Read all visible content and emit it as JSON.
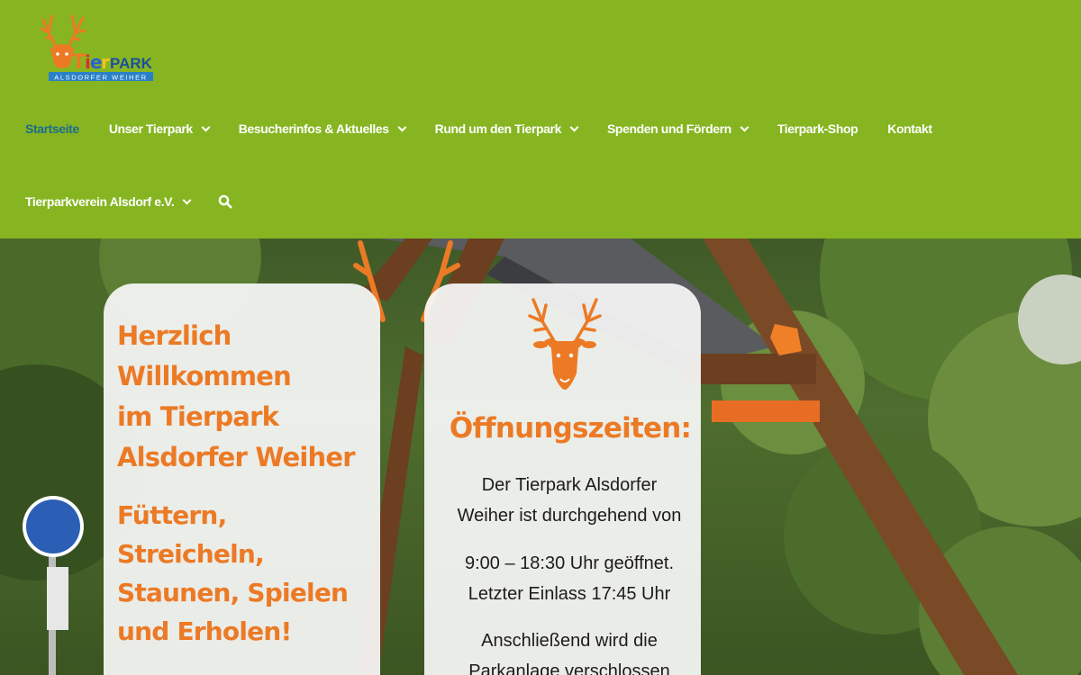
{
  "logo": {
    "name": "Tierpark",
    "sub": "ALSDORFER WEIHER"
  },
  "nav": {
    "row1": [
      {
        "label": "Startseite",
        "active": true,
        "dropdown": false
      },
      {
        "label": "Unser Tierpark",
        "active": false,
        "dropdown": true
      },
      {
        "label": "Besucherinfos & Aktuelles",
        "active": false,
        "dropdown": true
      },
      {
        "label": "Rund um den Tierpark",
        "active": false,
        "dropdown": true
      },
      {
        "label": "Spenden und Fördern",
        "active": false,
        "dropdown": true
      },
      {
        "label": "Tierpark-Shop",
        "active": false,
        "dropdown": false
      },
      {
        "label": "Kontakt",
        "active": false,
        "dropdown": false
      }
    ],
    "row2": [
      {
        "label": "Tierparkverein Alsdorf e.V.",
        "active": false,
        "dropdown": true
      }
    ],
    "search_icon": "search-icon"
  },
  "welcome": {
    "lines": [
      "Herzlich",
      "Willkommen",
      "im Tierpark",
      "Alsdorfer Weiher"
    ],
    "tagline": [
      "Füttern,",
      "Streicheln,",
      "Staunen, Spielen",
      "und Erholen!"
    ]
  },
  "hours": {
    "title": "Öffnungszeiten:",
    "p1": [
      "Der Tierpark Alsdorfer",
      "Weiher ist durchgehend von"
    ],
    "p2": [
      "9:00 – 18:30 Uhr geöffnet.",
      "Letzter Einlass 17:45 Uhr"
    ],
    "p3": [
      "Anschließend wird die",
      "Parkanlage verschlossen"
    ]
  },
  "colors": {
    "header_green": "#86b521",
    "accent_orange": "#ec7a25",
    "active_nav": "#1e6d8a"
  }
}
